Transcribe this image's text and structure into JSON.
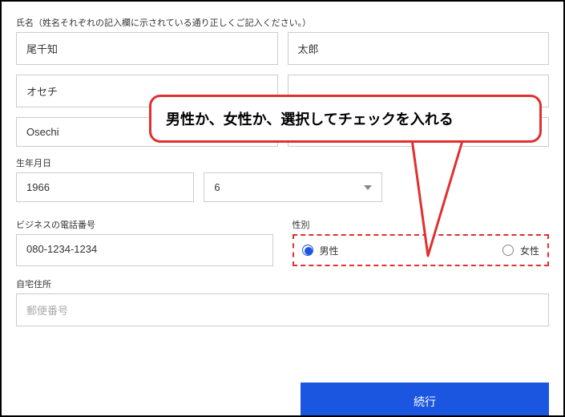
{
  "labels": {
    "name": "氏名（姓名それぞれの記入欄に示されている通り正しくご記入ください。）",
    "dob": "生年月日",
    "phone": "ビジネスの電話番号",
    "gender": "性別",
    "address": "自宅住所"
  },
  "name": {
    "family_kanji": "尾千知",
    "given_kanji": "太郎",
    "family_kana": "オセチ",
    "given_kana": "",
    "family_roman": "Osechi",
    "given_roman": ""
  },
  "dob": {
    "year": "1966",
    "month": "6"
  },
  "phone": "080-1234-1234",
  "gender": {
    "male": "男性",
    "female": "女性",
    "selected": "male"
  },
  "address_placeholder": "郵便番号",
  "submit": "続行",
  "callout_text": "男性か、女性か、選択してチェックを入れる"
}
